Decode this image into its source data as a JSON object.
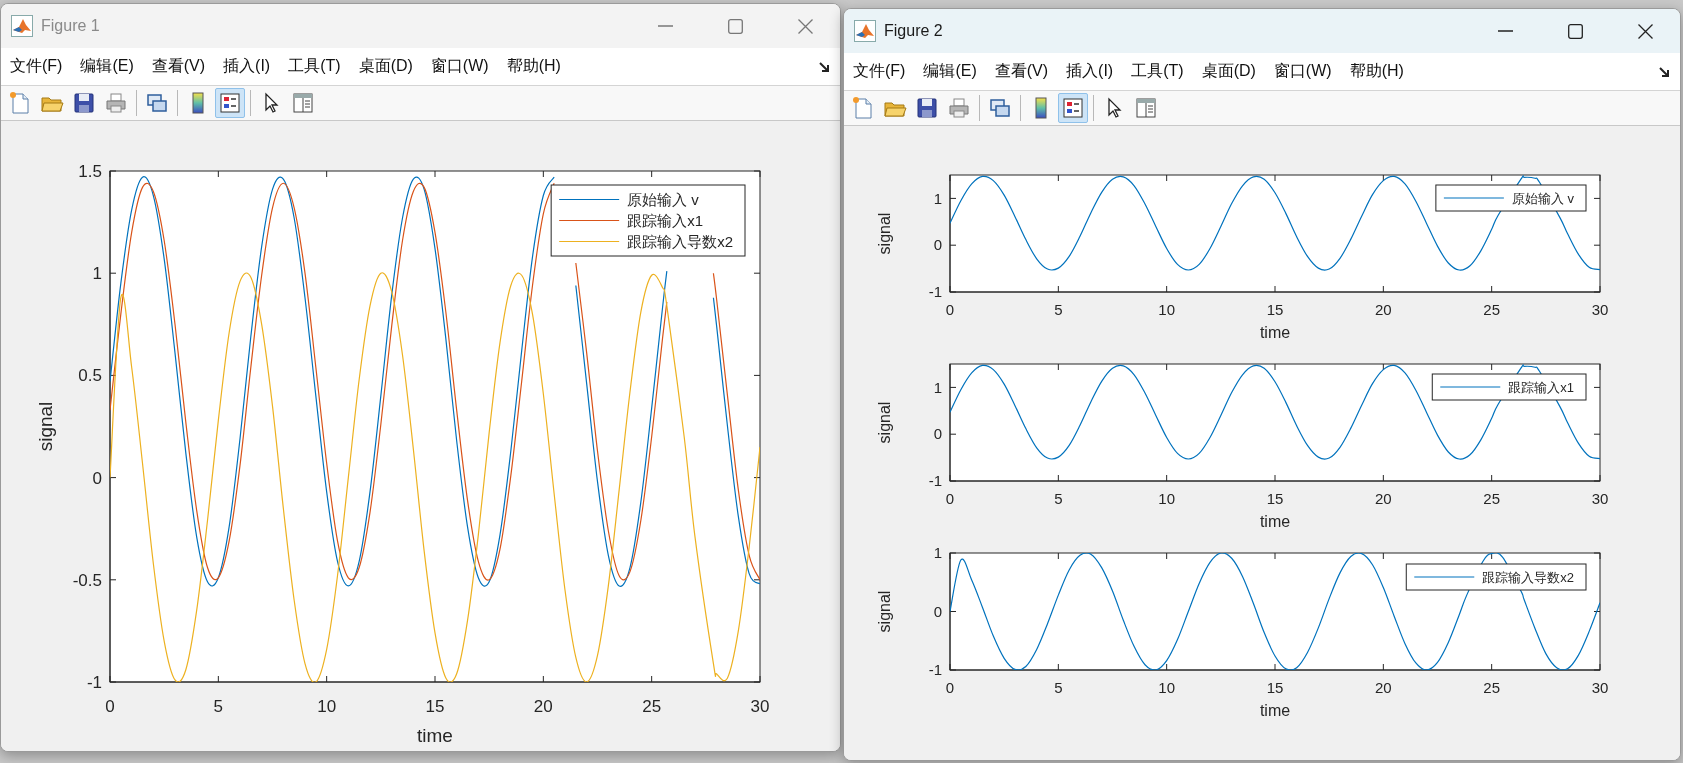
{
  "windows": [
    {
      "title": "Figure 1",
      "active": false,
      "menu": [
        "文件(F)",
        "编辑(E)",
        "查看(V)",
        "插入(I)",
        "工具(T)",
        "桌面(D)",
        "窗口(W)",
        "帮助(H)"
      ],
      "toolbar": [
        {
          "kind": "new-file",
          "pressed": false
        },
        {
          "kind": "open-folder",
          "pressed": false
        },
        {
          "kind": "save",
          "pressed": false
        },
        {
          "kind": "print",
          "pressed": false
        },
        {
          "kind": "separator"
        },
        {
          "kind": "link",
          "pressed": false
        },
        {
          "kind": "separator"
        },
        {
          "kind": "colorbar",
          "pressed": false
        },
        {
          "kind": "legend",
          "pressed": true
        },
        {
          "kind": "separator"
        },
        {
          "kind": "pointer",
          "pressed": false
        },
        {
          "kind": "panel",
          "pressed": false
        }
      ],
      "axes": [
        {
          "chart_data": {
            "type": "line",
            "xlabel": "time",
            "ylabel": "signal",
            "xlim": [
              0,
              30
            ],
            "ylim": [
              -1,
              1.5
            ],
            "xticks": [
              0,
              5,
              10,
              15,
              20,
              25,
              30
            ],
            "yticks": [
              -1,
              -0.5,
              0,
              0.5,
              1,
              1.5
            ],
            "legend": "top right",
            "x": [
              0,
              0.5,
              1,
              1.5,
              2,
              2.5,
              3,
              3.5,
              4,
              4.5,
              5,
              5.5,
              6,
              6.5,
              7,
              7.5,
              8,
              8.5,
              9,
              9.5,
              10,
              10.5,
              11,
              11.5,
              12,
              12.5,
              13,
              13.5,
              14,
              14.5,
              15,
              15.5,
              16,
              16.5,
              17,
              17.5,
              18,
              18.5,
              19,
              19.5,
              20,
              20.5,
              21,
              21.5,
              22,
              22.5,
              23,
              23.5,
              24,
              24.5,
              25,
              25.5,
              25.7,
              26.5,
              27,
              27.85,
              28,
              28.5,
              29,
              29.5,
              30
            ],
            "series": [
              {
                "name": "原始输入 v",
                "color": "#0072bd",
                "values": [
                  0.47,
                  0.95,
                  1.31,
                  1.47,
                  1.38,
                  1.07,
                  0.61,
                  0.12,
                  -0.29,
                  -0.51,
                  -0.49,
                  -0.24,
                  0.19,
                  0.69,
                  1.13,
                  1.41,
                  1.46,
                  1.27,
                  0.88,
                  0.4,
                  -0.07,
                  -0.41,
                  -0.53,
                  -0.41,
                  -0.07,
                  0.4,
                  0.89,
                  1.27,
                  1.46,
                  1.41,
                  1.12,
                  0.68,
                  0.18,
                  -0.24,
                  -0.49,
                  -0.51,
                  -0.28,
                  0.13,
                  0.62,
                  1.08,
                  1.38,
                  1.47,
                  null,
                  0.94,
                  0.46,
                  -0.02,
                  -0.38,
                  -0.53,
                  -0.44,
                  -0.12,
                  0.34,
                  0.83,
                  1.01,
                  null,
                  null,
                  0.88,
                  0.74,
                  0.25,
                  -0.19,
                  -0.47,
                  -0.52
                ]
              },
              {
                "name": "跟踪输入x1",
                "color": "#d95319",
                "values": [
                  0.33,
                  0.8,
                  1.2,
                  1.42,
                  1.4,
                  1.16,
                  0.75,
                  0.27,
                  -0.16,
                  -0.44,
                  -0.49,
                  -0.31,
                  0.06,
                  0.54,
                  0.99,
                  1.32,
                  1.44,
                  1.32,
                  1.0,
                  0.54,
                  0.07,
                  -0.31,
                  -0.49,
                  -0.44,
                  -0.17,
                  0.26,
                  0.74,
                  1.16,
                  1.4,
                  1.42,
                  1.2,
                  0.81,
                  0.33,
                  -0.11,
                  -0.41,
                  -0.5,
                  -0.35,
                  0.01,
                  0.47,
                  0.94,
                  1.29,
                  1.44,
                  null,
                  1.05,
                  0.61,
                  0.13,
                  -0.26,
                  -0.48,
                  -0.46,
                  -0.21,
                  0.2,
                  0.68,
                  0.86,
                  null,
                  null,
                  1.0,
                  0.87,
                  0.4,
                  -0.06,
                  -0.38,
                  -0.5
                ]
              },
              {
                "name": "跟踪输入导数x2",
                "color": "#edb120",
                "values": [
                  0,
                  0.88,
                  0.54,
                  0.07,
                  -0.42,
                  -0.8,
                  -0.99,
                  -0.94,
                  -0.65,
                  -0.21,
                  0.28,
                  0.71,
                  0.96,
                  0.98,
                  0.75,
                  0.35,
                  -0.15,
                  -0.6,
                  -0.91,
                  -1.0,
                  -0.84,
                  -0.48,
                  0.0,
                  0.48,
                  0.84,
                  1.0,
                  0.91,
                  0.6,
                  0.14,
                  -0.36,
                  -0.76,
                  -0.98,
                  -0.96,
                  -0.7,
                  -0.28,
                  0.22,
                  0.66,
                  0.94,
                  0.99,
                  0.8,
                  0.41,
                  -0.08,
                  -0.55,
                  -0.88,
                  -1.0,
                  -0.87,
                  -0.53,
                  -0.06,
                  0.42,
                  0.81,
                  0.99,
                  0.93,
                  0.84,
                  0.2,
                  -0.29,
                  -0.91,
                  -0.96,
                  -0.98,
                  -0.75,
                  -0.34,
                  0.15
                ]
              }
            ]
          }
        }
      ]
    },
    {
      "title": "Figure 2",
      "active": true,
      "menu": [
        "文件(F)",
        "编辑(E)",
        "查看(V)",
        "插入(I)",
        "工具(T)",
        "桌面(D)",
        "窗口(W)",
        "帮助(H)"
      ],
      "toolbar": [
        {
          "kind": "new-file",
          "pressed": false
        },
        {
          "kind": "open-folder",
          "pressed": false
        },
        {
          "kind": "save",
          "pressed": false
        },
        {
          "kind": "print",
          "pressed": false
        },
        {
          "kind": "separator"
        },
        {
          "kind": "link",
          "pressed": false
        },
        {
          "kind": "separator"
        },
        {
          "kind": "colorbar",
          "pressed": false
        },
        {
          "kind": "legend",
          "pressed": true
        },
        {
          "kind": "separator"
        },
        {
          "kind": "pointer",
          "pressed": false
        },
        {
          "kind": "panel",
          "pressed": false
        }
      ],
      "axes": [
        {
          "chart_data": {
            "type": "line",
            "xlabel": "time",
            "ylabel": "signal",
            "xlim": [
              0,
              30
            ],
            "ylim": [
              -1,
              1.5
            ],
            "xticks": [
              0,
              5,
              10,
              15,
              20,
              25,
              30
            ],
            "yticks": [
              -1,
              0,
              1
            ],
            "legend": "top right",
            "x": [
              0,
              0.5,
              1,
              1.5,
              2,
              2.5,
              3,
              3.5,
              4,
              4.5,
              5,
              5.5,
              6,
              6.5,
              7,
              7.5,
              8,
              8.5,
              9,
              9.5,
              10,
              10.5,
              11,
              11.5,
              12,
              12.5,
              13,
              13.5,
              14,
              14.5,
              15,
              15.5,
              16,
              16.5,
              17,
              17.5,
              18,
              18.5,
              19,
              19.5,
              20,
              20.5,
              21,
              21.5,
              22,
              22.5,
              23,
              23.5,
              24,
              24.5,
              25,
              25.3,
              26.35,
              26.5,
              27,
              27.2,
              28.15,
              28.5,
              29,
              29.5,
              30
            ],
            "series": [
              {
                "name": "原始输入 v",
                "color": "#0072bd",
                "values": [
                  0.47,
                  0.95,
                  1.31,
                  1.47,
                  1.38,
                  1.07,
                  0.61,
                  0.12,
                  -0.29,
                  -0.51,
                  -0.49,
                  -0.24,
                  0.19,
                  0.69,
                  1.13,
                  1.41,
                  1.46,
                  1.27,
                  0.88,
                  0.4,
                  -0.07,
                  -0.41,
                  -0.53,
                  -0.41,
                  -0.07,
                  0.4,
                  0.89,
                  1.27,
                  1.46,
                  1.41,
                  1.12,
                  0.68,
                  0.18,
                  -0.24,
                  -0.49,
                  -0.51,
                  -0.28,
                  0.13,
                  0.62,
                  1.08,
                  1.38,
                  1.47,
                  1.31,
                  0.94,
                  0.46,
                  -0.02,
                  -0.38,
                  -0.53,
                  -0.44,
                  -0.12,
                  0.34,
                  0.64,
                  1.41,
                  1.45,
                  1.43,
                  1.35,
                  0.59,
                  0.25,
                  -0.19,
                  -0.47,
                  -0.52
                ]
              }
            ]
          }
        },
        {
          "chart_data": {
            "type": "line",
            "xlabel": "time",
            "ylabel": "signal",
            "xlim": [
              0,
              30
            ],
            "ylim": [
              -1,
              1.5
            ],
            "xticks": [
              0,
              5,
              10,
              15,
              20,
              25,
              30
            ],
            "yticks": [
              -1,
              0,
              1
            ],
            "legend": "top right",
            "x": [
              0,
              0.5,
              1,
              1.5,
              2,
              2.5,
              3,
              3.5,
              4,
              4.5,
              5,
              5.5,
              6,
              6.5,
              7,
              7.5,
              8,
              8.5,
              9,
              9.5,
              10,
              10.5,
              11,
              11.5,
              12,
              12.5,
              13,
              13.5,
              14,
              14.5,
              15,
              15.5,
              16,
              16.5,
              17,
              17.5,
              18,
              18.5,
              19,
              19.5,
              20,
              20.5,
              21,
              21.5,
              22,
              22.5,
              23,
              23.5,
              24,
              24.5,
              25,
              25.3,
              26.35,
              26.5,
              27,
              27.2,
              28.15,
              28.5,
              29,
              29.5,
              30
            ],
            "series": [
              {
                "name": "跟踪输入x1",
                "color": "#0072bd",
                "values": [
                  0.47,
                  0.95,
                  1.31,
                  1.47,
                  1.38,
                  1.07,
                  0.61,
                  0.12,
                  -0.29,
                  -0.51,
                  -0.49,
                  -0.24,
                  0.19,
                  0.69,
                  1.13,
                  1.41,
                  1.46,
                  1.27,
                  0.88,
                  0.4,
                  -0.07,
                  -0.41,
                  -0.53,
                  -0.41,
                  -0.07,
                  0.4,
                  0.89,
                  1.27,
                  1.46,
                  1.41,
                  1.12,
                  0.68,
                  0.18,
                  -0.24,
                  -0.49,
                  -0.51,
                  -0.28,
                  0.13,
                  0.62,
                  1.08,
                  1.38,
                  1.47,
                  1.31,
                  0.94,
                  0.46,
                  -0.02,
                  -0.38,
                  -0.53,
                  -0.44,
                  -0.12,
                  0.34,
                  0.64,
                  1.41,
                  1.45,
                  1.43,
                  1.35,
                  0.59,
                  0.25,
                  -0.19,
                  -0.47,
                  -0.52
                ]
              }
            ]
          }
        },
        {
          "chart_data": {
            "type": "line",
            "xlabel": "time",
            "ylabel": "signal",
            "xlim": [
              0,
              30
            ],
            "ylim": [
              -1,
              1
            ],
            "xticks": [
              0,
              5,
              10,
              15,
              20,
              25,
              30
            ],
            "yticks": [
              -1,
              0,
              1
            ],
            "legend": "top right",
            "x": [
              0,
              0.5,
              1,
              1.5,
              2,
              2.5,
              3,
              3.5,
              4,
              4.5,
              5,
              5.5,
              6,
              6.5,
              7,
              7.5,
              8,
              8.5,
              9,
              9.5,
              10,
              10.5,
              11,
              11.5,
              12,
              12.5,
              13,
              13.5,
              14,
              14.5,
              15,
              15.5,
              16,
              16.5,
              17,
              17.5,
              18,
              18.5,
              19,
              19.5,
              20,
              20.5,
              21,
              21.5,
              22,
              22.5,
              23,
              23.5,
              23.85,
              24.6,
              25,
              25.5,
              26.35,
              26.5,
              27,
              27.5,
              28,
              28.5,
              29,
              29.5,
              30
            ],
            "series": [
              {
                "name": "跟踪输入导数x2",
                "color": "#0072bd",
                "values": [
                  0,
                  0.88,
                  0.54,
                  0.07,
                  -0.42,
                  -0.8,
                  -0.99,
                  -0.94,
                  -0.65,
                  -0.21,
                  0.28,
                  0.71,
                  0.96,
                  0.98,
                  0.75,
                  0.35,
                  -0.15,
                  -0.6,
                  -0.91,
                  -1.0,
                  -0.84,
                  -0.48,
                  0.0,
                  0.48,
                  0.84,
                  1.0,
                  0.91,
                  0.6,
                  0.14,
                  -0.36,
                  -0.76,
                  -0.98,
                  -0.96,
                  -0.7,
                  -0.28,
                  0.22,
                  0.66,
                  0.94,
                  0.99,
                  0.8,
                  0.41,
                  -0.08,
                  -0.55,
                  -0.88,
                  -1.0,
                  -0.87,
                  -0.53,
                  -0.06,
                  0.28,
                  0.86,
                  0.99,
                  0.93,
                  0.35,
                  0.2,
                  -0.29,
                  -0.72,
                  -0.96,
                  -0.98,
                  -0.75,
                  -0.34,
                  0.15
                ]
              }
            ]
          }
        }
      ]
    }
  ]
}
